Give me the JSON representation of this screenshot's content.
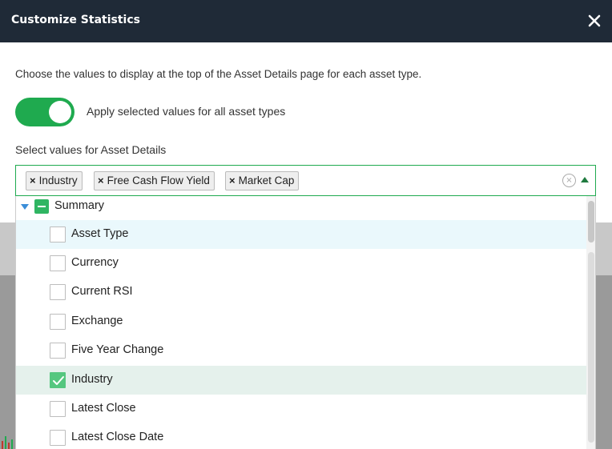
{
  "modal": {
    "title": "Customize Statistics",
    "description": "Choose the values to display at the top of the Asset Details page for each asset type.",
    "toggle": {
      "on": true,
      "label": "Apply selected values for all asset types"
    },
    "select_label": "Select values for Asset Details"
  },
  "selected_chips": [
    {
      "label": "Industry"
    },
    {
      "label": "Free Cash Flow Yield"
    },
    {
      "label": "Market Cap"
    }
  ],
  "chip_remove_glyph": "×",
  "clear_glyph": "×",
  "dropdown": {
    "group": {
      "label": "Summary",
      "state": "partial",
      "expanded": true
    },
    "items": [
      {
        "label": "Asset Type",
        "checked": false,
        "state": "hover"
      },
      {
        "label": "Currency",
        "checked": false,
        "state": ""
      },
      {
        "label": "Current RSI",
        "checked": false,
        "state": ""
      },
      {
        "label": "Exchange",
        "checked": false,
        "state": ""
      },
      {
        "label": "Five Year Change",
        "checked": false,
        "state": ""
      },
      {
        "label": "Industry",
        "checked": true,
        "state": "selected"
      },
      {
        "label": "Latest Close",
        "checked": false,
        "state": ""
      },
      {
        "label": "Latest Close Date",
        "checked": false,
        "state": ""
      }
    ]
  },
  "colors": {
    "header_bg": "#1f2a37",
    "accent_green": "#1faa4f",
    "check_green": "#55c77f",
    "caret_blue": "#3b8ed8",
    "hover_row": "#eaf8fc",
    "selected_row": "#e5f1ec"
  },
  "icons": {
    "close": "close-icon",
    "chip_remove": "x-icon",
    "clear": "clear-circle-icon",
    "collapse": "caret-up-icon",
    "group_expand": "caret-down-icon",
    "check": "checkmark-icon"
  }
}
